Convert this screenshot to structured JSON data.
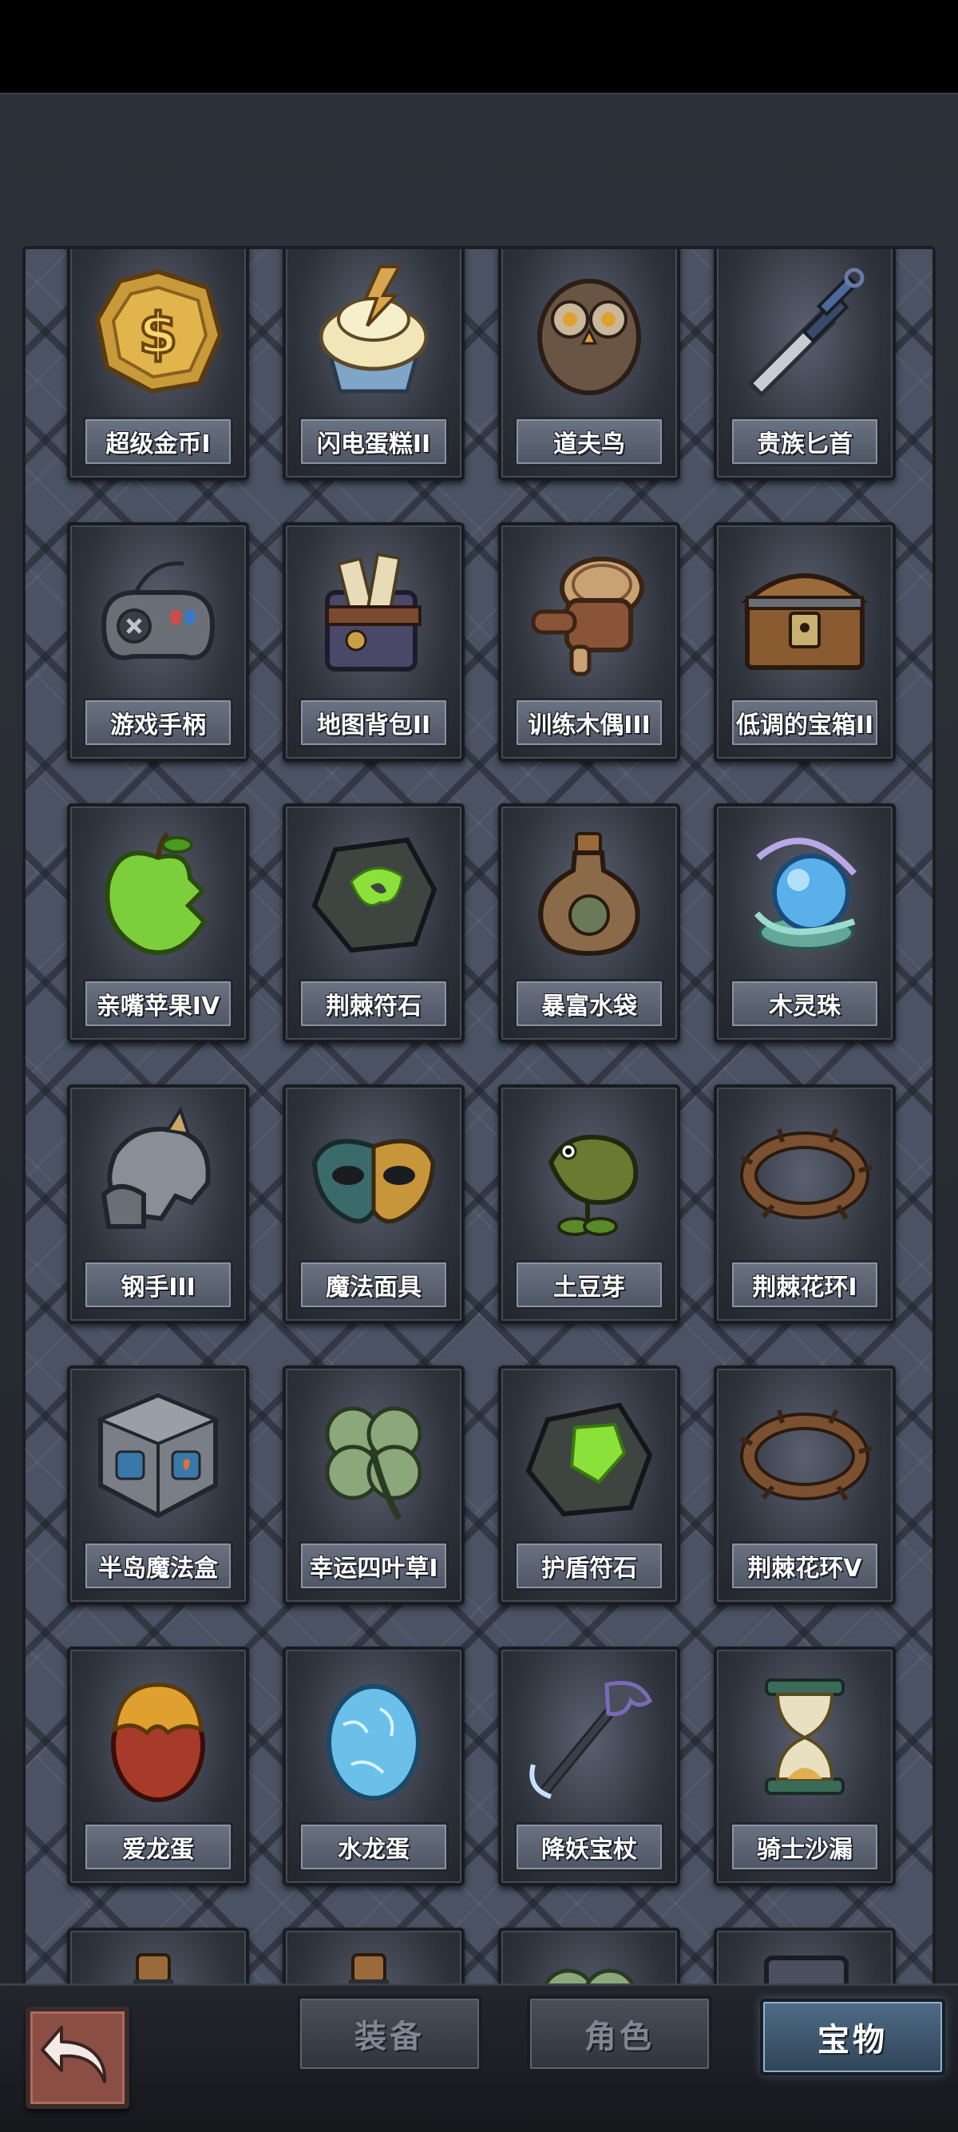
{
  "items": [
    {
      "name": "超级金币I",
      "icon": "gold-coin-icon"
    },
    {
      "name": "闪电蛋糕II",
      "icon": "lightning-cake-icon"
    },
    {
      "name": "道夫鸟",
      "icon": "owl-icon"
    },
    {
      "name": "贵族匕首",
      "icon": "dagger-icon"
    },
    {
      "name": "游戏手柄",
      "icon": "gamepad-icon"
    },
    {
      "name": "地图背包II",
      "icon": "map-backpack-icon"
    },
    {
      "name": "训练木偶III",
      "icon": "wooden-dummy-icon"
    },
    {
      "name": "低调的宝箱II",
      "icon": "treasure-chest-icon"
    },
    {
      "name": "亲嘴苹果IV",
      "icon": "bitten-apple-icon"
    },
    {
      "name": "荆棘符石",
      "icon": "thorn-rune-stone-icon"
    },
    {
      "name": "暴富水袋",
      "icon": "water-pouch-icon"
    },
    {
      "name": "木灵珠",
      "icon": "wood-spirit-orb-icon"
    },
    {
      "name": "钢手III",
      "icon": "steel-gauntlet-icon"
    },
    {
      "name": "魔法面具",
      "icon": "magic-mask-icon"
    },
    {
      "name": "土豆芽",
      "icon": "potato-sprout-icon"
    },
    {
      "name": "荆棘花环I",
      "icon": "thorn-wreath-icon"
    },
    {
      "name": "半岛魔法盒",
      "icon": "magic-cube-icon"
    },
    {
      "name": "幸运四叶草I",
      "icon": "four-leaf-clover-icon"
    },
    {
      "name": "护盾符石",
      "icon": "shield-rune-stone-icon"
    },
    {
      "name": "荆棘花环V",
      "icon": "thorn-wreath-icon"
    },
    {
      "name": "爱龙蛋",
      "icon": "red-dragon-egg-icon"
    },
    {
      "name": "水龙蛋",
      "icon": "water-dragon-egg-icon"
    },
    {
      "name": "降妖宝杖",
      "icon": "demon-staff-icon"
    },
    {
      "name": "骑士沙漏",
      "icon": "hourglass-icon"
    },
    {
      "name": "",
      "icon": "pink-potion-icon"
    },
    {
      "name": "",
      "icon": "pink-potion-icon"
    },
    {
      "name": "",
      "icon": "four-leaf-clover-icon"
    },
    {
      "name": "",
      "icon": "armor-belt-icon"
    }
  ],
  "tabs": [
    {
      "label": "装备",
      "active": false
    },
    {
      "label": "角色",
      "active": false
    },
    {
      "label": "宝物",
      "active": true
    }
  ],
  "back_icon": "back-arrow-icon",
  "colors": {
    "panel_bg": "#2d3139",
    "grid_bg": "#4a5263",
    "active_tab": "#4f6c86",
    "back_button": "#8a4e45"
  }
}
